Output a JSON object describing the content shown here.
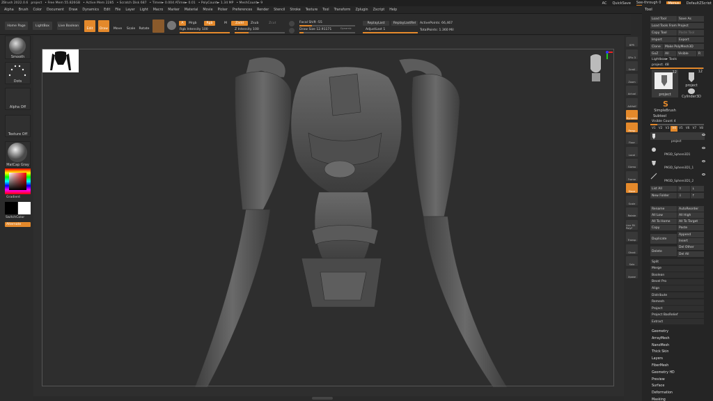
{
  "title_bar": {
    "app": "ZBrush 2022.0.6",
    "project": "project",
    "free_mem": "• Free Mem 55.826GB",
    "active_mem": "• Active Mem 2285",
    "scratch_disk": "• Scratch Disk 687",
    "timer": "• Timer► 0.004 ATime► 0.01",
    "poly_count": "• PolyCount► 1.34 MP",
    "mesh_count": "• MeshCount► 9"
  },
  "top_right": {
    "ac": "AC",
    "quicksave": "QuickSave",
    "seethrough": "See-through 0",
    "menus": "Menus",
    "default_script": "DefaultZScript"
  },
  "menu": [
    "Alpha",
    "Brush",
    "Color",
    "Document",
    "Draw",
    "Dynamics",
    "Edit",
    "File",
    "Layer",
    "Light",
    "Macro",
    "Marker",
    "Material",
    "Movie",
    "Picker",
    "Preferences",
    "Render",
    "Stencil",
    "Stroke",
    "Texture",
    "Tool",
    "Transform",
    "Zplugin",
    "Zscript",
    "Help"
  ],
  "toolbar": {
    "home_page": "Home Page",
    "lightbox": "LightBox",
    "live_boolean": "Live Boolean",
    "edit": "Edit",
    "draw": "Draw",
    "move": "Move",
    "scale": "Scale",
    "rotate": "Rotate",
    "a": "A",
    "mrgb": "Mrgb",
    "rgb": "Rgb",
    "m": "M",
    "zadd": "Zadd",
    "zsub": "Zsub",
    "zcut": "Zcut",
    "rgb_intensity": "Rgb Intensity 100",
    "z_intensity": "Z Intensity 100",
    "focal_shift": "Focal Shift -55",
    "draw_size": "Draw Size 12.91171",
    "dynamic": "Dynamic",
    "replay_last": "ReplayLast",
    "replay_last_rel": "ReplayLastRel",
    "adjust_last": "AdjustLast 1",
    "active_points": "ActivePoints: 66,467",
    "total_points": "TotalPoints: 1.360 Mil"
  },
  "left_shelf": {
    "smooth": "Smooth",
    "dots": "Dots",
    "alpha_off": "Alpha Off",
    "texture_off": "Texture Off",
    "matcap": "MatCap Gray",
    "gradient": "Gradient",
    "switch_color": "SwitchColor",
    "alternate": "Alternate"
  },
  "right_shelf": [
    "BPR",
    "SPix 3",
    "Scroll",
    "Zoom",
    "Actual",
    "AAHalf",
    "Dynamic",
    "Persp",
    "Floor",
    "Local",
    "Gizmo",
    "Frame",
    "Move",
    "Scale",
    "Rotate",
    "Line Fill PolyF",
    "Transp",
    "Ghost",
    "Solo",
    "Xpose"
  ],
  "tool_panel": {
    "title": "Tool",
    "load_tool": "Load Tool",
    "save_as": "Save As",
    "load_from_project": "Load Tools From Project",
    "copy_tool": "Copy Tool",
    "paste_tool": "Paste Tool",
    "import": "Import",
    "export": "Export",
    "clone": "Clone",
    "make_polymesh": "Make PolyMesh3D",
    "goz": "GoZ",
    "all": "All",
    "visible": "Visible",
    "r": "R",
    "lightbox_tools": "Lightbox► Tools",
    "project_count": "project. 48",
    "thumb_count_1": "12",
    "thumb_count_2": "12",
    "thumb_label_1": "project",
    "thumb_label_2": "project",
    "cylinder": "Cylinder3D",
    "simplebrush": "SimpleBrush",
    "subtool": "Subtool",
    "visible_count": "Visible Count 4",
    "v_tabs": [
      "V1",
      "V2",
      "V3",
      "V4",
      "V5",
      "V6",
      "V7",
      "V8"
    ],
    "subtools": [
      "project",
      "PM3D_Sphere3D1",
      "PM3D_Sphere3D1_1",
      "PM3D_Sphere3D1_2"
    ],
    "list_all": "List All",
    "new_folder": "New Folder",
    "rename": "Rename",
    "autoreorder": "AutoReorder",
    "all_low": "All Low",
    "all_high": "All High",
    "all_to_home": "All To Home",
    "all_to_target": "All To Target",
    "copy": "Copy",
    "paste": "Paste",
    "append": "Append",
    "duplicate": "Duplicate",
    "insert": "Insert",
    "del_other": "Del Other",
    "delete": "Delete",
    "del_all": "Del All",
    "actions": [
      "Split",
      "Merge",
      "Boolean",
      "Bevel Pro",
      "Align",
      "Distribute",
      "Remesh",
      "Project",
      "Project BasRelief",
      "Extract"
    ],
    "sections": [
      "Geometry",
      "ArrayMesh",
      "NanoMesh",
      "Thick Skin",
      "Layers",
      "FiberMesh",
      "Geometry HD",
      "Preview",
      "Surface",
      "Deformation",
      "Masking"
    ]
  },
  "colors": {
    "accent": "#e4892b",
    "bg": "#2e2e2e",
    "panel": "#252525"
  }
}
